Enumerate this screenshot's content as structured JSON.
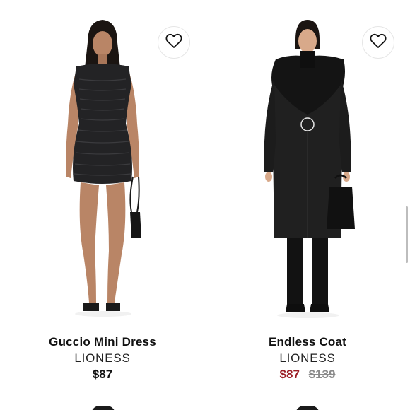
{
  "products": [
    {
      "name": "Guccio Mini Dress",
      "brand": "LIONESS",
      "price": "$87",
      "icon": "heart-outline-icon"
    },
    {
      "name": "Endless Coat",
      "brand": "LIONESS",
      "sale_price": "$87",
      "original_price": "$139",
      "icon": "heart-outline-icon"
    }
  ],
  "colors": {
    "sale": "#9b1c24",
    "strikethrough": "#8a8a8a",
    "text": "#111111"
  }
}
